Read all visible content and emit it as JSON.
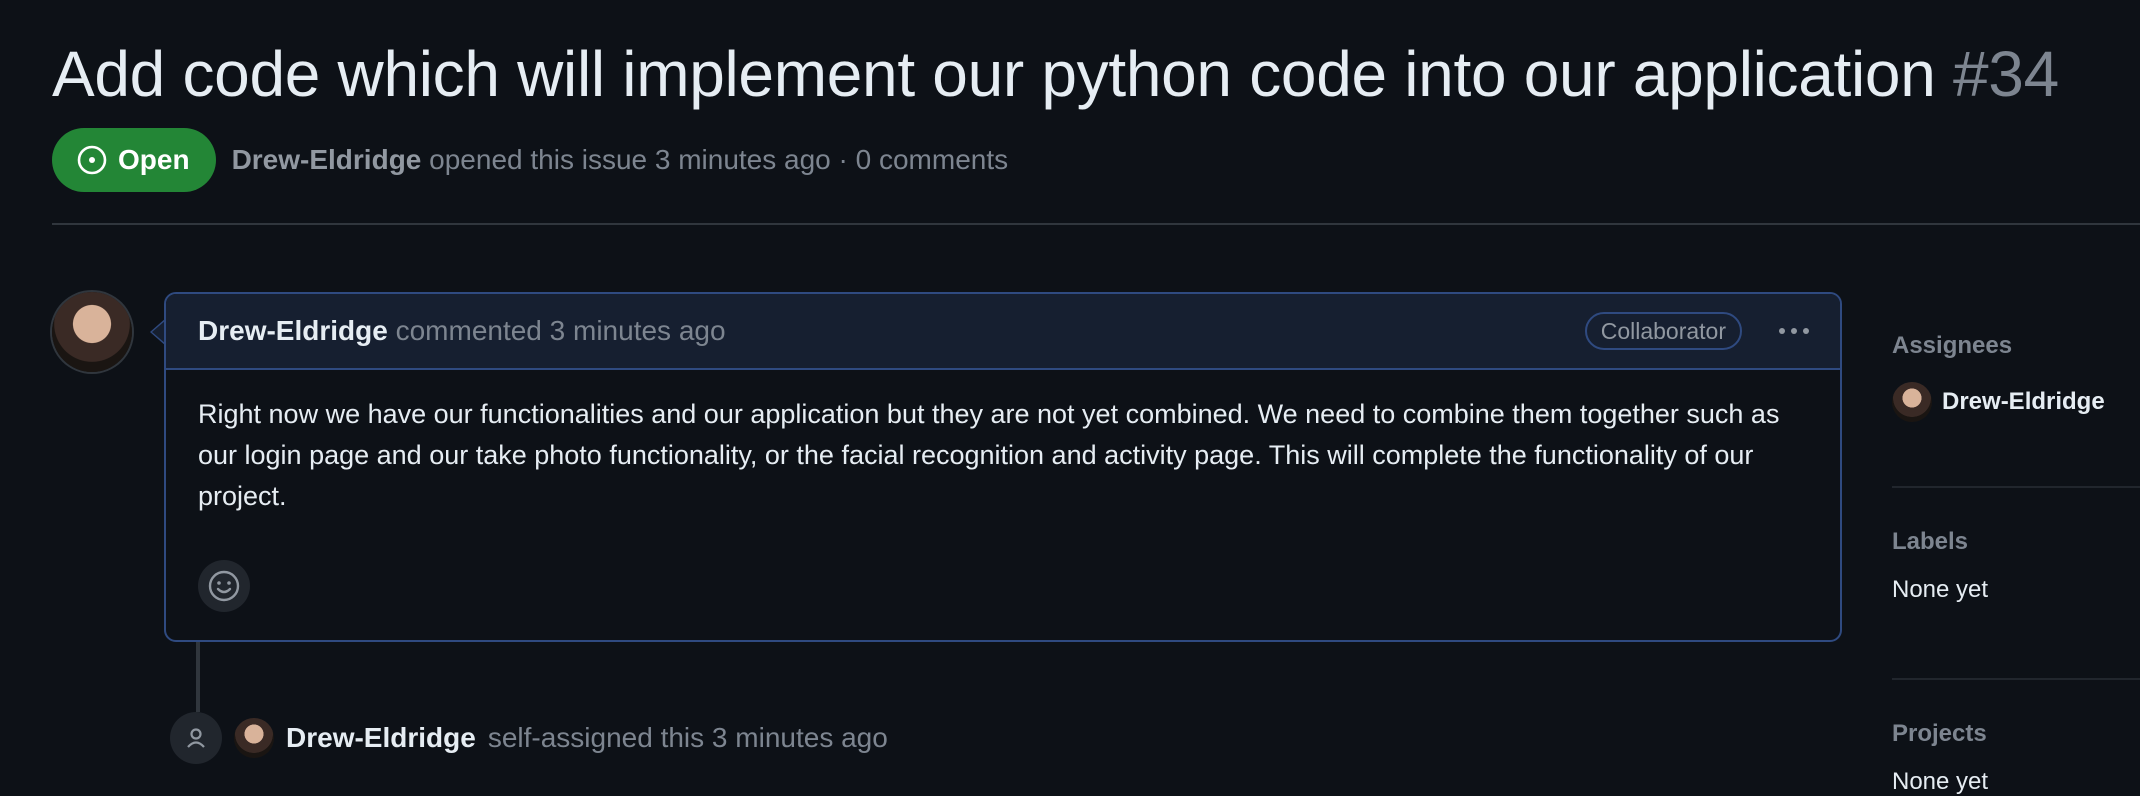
{
  "issue": {
    "title": "Add code which will implement our python code into our application",
    "number": "#34",
    "state": "Open",
    "author": "Drew-Eldridge",
    "opened_text": "opened this issue 3 minutes ago · 0 comments"
  },
  "comment": {
    "author": "Drew-Eldridge",
    "action_text": "commented 3 minutes ago",
    "role_badge": "Collaborator",
    "body": "Right now we have our functionalities and our application but they are not yet combined. We need to combine them together such as our login page and our take photo functionality, or the facial recognition and activity page. This will complete the functionality of our project."
  },
  "timeline_event": {
    "author": "Drew-Eldridge",
    "text": "self-assigned this 3 minutes ago"
  },
  "sidebar": {
    "assignees": {
      "heading": "Assignees",
      "name": "Drew-Eldridge"
    },
    "labels": {
      "heading": "Labels",
      "value": "None yet"
    },
    "projects": {
      "heading": "Projects",
      "value": "None yet"
    }
  },
  "colors": {
    "background": "#0d1117",
    "open_green": "#238636",
    "comment_border": "#2f4a80",
    "muted_text": "#7d8590"
  },
  "icons": {
    "state": "issue-opened-icon",
    "reaction": "smiley-icon",
    "menu": "kebab-horizontal-icon",
    "event": "person-icon"
  }
}
